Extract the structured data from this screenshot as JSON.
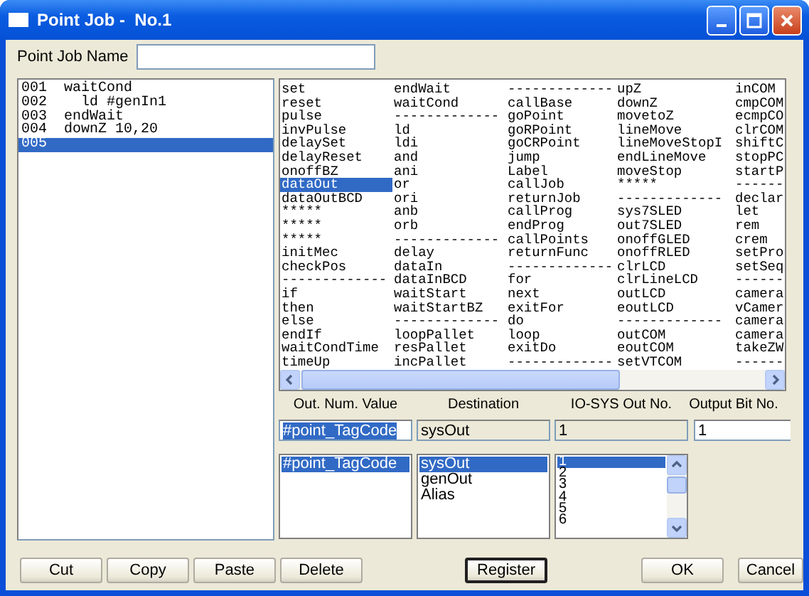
{
  "window": {
    "title": "Point Job -  No.1"
  },
  "job_name": {
    "label": "Point Job Name"
  },
  "code_lines": [
    {
      "no": "001",
      "text": "waitCond",
      "selected": false,
      "children": [
        {
          "no": "002",
          "text": "ld #genIn1",
          "selected": false
        }
      ]
    },
    {
      "no": "003",
      "text": "endWait",
      "selected": false
    },
    {
      "no": "004",
      "text": "downZ 10,20",
      "selected": false
    },
    {
      "no": "005",
      "selected": true
    }
  ],
  "commands": [
    [
      {
        "text": "set",
        "selected": false
      },
      {
        "text": "endWait",
        "selected": false
      },
      {
        "text": "-------------",
        "selected": false
      },
      {
        "text": "upZ",
        "selected": false
      },
      {
        "text": "inCOM",
        "selected": false
      }
    ],
    [
      {
        "text": "reset",
        "selected": false
      },
      {
        "text": "waitCond",
        "selected": false
      },
      {
        "text": "callBase",
        "selected": false
      },
      {
        "text": "downZ",
        "selected": false
      },
      {
        "text": "cmpCOM",
        "selected": false
      }
    ],
    [
      {
        "text": "pulse",
        "selected": false
      },
      {
        "text": "-------------",
        "selected": false
      },
      {
        "text": "goPoint",
        "selected": false
      },
      {
        "text": "movetoZ",
        "selected": false
      },
      {
        "text": "ecmpCO",
        "selected": false
      }
    ],
    [
      {
        "text": "invPulse",
        "selected": false
      },
      {
        "text": "ld",
        "selected": false
      },
      {
        "text": "goRPoint",
        "selected": false
      },
      {
        "text": "lineMove",
        "selected": false
      },
      {
        "text": "clrCOM",
        "selected": false
      }
    ],
    [
      {
        "text": "delaySet",
        "selected": false
      },
      {
        "text": "ldi",
        "selected": false
      },
      {
        "text": "goCRPoint",
        "selected": false
      },
      {
        "text": "lineMoveStopI",
        "selected": false
      },
      {
        "text": "shiftC",
        "selected": false
      }
    ],
    [
      {
        "text": "delayReset",
        "selected": false
      },
      {
        "text": "and",
        "selected": false
      },
      {
        "text": "jump",
        "selected": false
      },
      {
        "text": "endLineMove",
        "selected": false
      },
      {
        "text": "stopPC",
        "selected": false
      }
    ],
    [
      {
        "text": "onoffBZ",
        "selected": false
      },
      {
        "text": "ani",
        "selected": false
      },
      {
        "text": "Label",
        "selected": false
      },
      {
        "text": "moveStop",
        "selected": false
      },
      {
        "text": "startP",
        "selected": false
      }
    ],
    [
      {
        "text": "dataOut",
        "selected": true
      },
      {
        "text": "or",
        "selected": false
      },
      {
        "text": "callJob",
        "selected": false
      },
      {
        "text": "*****",
        "selected": false
      },
      {
        "text": "------",
        "selected": false
      }
    ],
    [
      {
        "text": "dataOutBCD",
        "selected": false
      },
      {
        "text": "ori",
        "selected": false
      },
      {
        "text": "returnJob",
        "selected": false
      },
      {
        "text": "-------------",
        "selected": false
      },
      {
        "text": "declar",
        "selected": false
      }
    ],
    [
      {
        "text": "*****",
        "selected": false
      },
      {
        "text": "anb",
        "selected": false
      },
      {
        "text": "callProg",
        "selected": false
      },
      {
        "text": "sys7SLED",
        "selected": false
      },
      {
        "text": "let",
        "selected": false
      }
    ],
    [
      {
        "text": "*****",
        "selected": false
      },
      {
        "text": "orb",
        "selected": false
      },
      {
        "text": "endProg",
        "selected": false
      },
      {
        "text": "out7SLED",
        "selected": false
      },
      {
        "text": "rem",
        "selected": false
      }
    ],
    [
      {
        "text": "*****",
        "selected": false
      },
      {
        "text": "-------------",
        "selected": false
      },
      {
        "text": "callPoints",
        "selected": false
      },
      {
        "text": "onoffGLED",
        "selected": false
      },
      {
        "text": "crem",
        "selected": false
      }
    ],
    [
      {
        "text": "initMec",
        "selected": false
      },
      {
        "text": "delay",
        "selected": false
      },
      {
        "text": "returnFunc",
        "selected": false
      },
      {
        "text": "onoffRLED",
        "selected": false
      },
      {
        "text": "setPro",
        "selected": false
      }
    ],
    [
      {
        "text": "checkPos",
        "selected": false
      },
      {
        "text": "dataIn",
        "selected": false
      },
      {
        "text": "-------------",
        "selected": false
      },
      {
        "text": "clrLCD",
        "selected": false
      },
      {
        "text": "setSeq",
        "selected": false
      }
    ],
    [
      {
        "text": "-------------",
        "selected": false
      },
      {
        "text": "dataInBCD",
        "selected": false
      },
      {
        "text": "for",
        "selected": false
      },
      {
        "text": "clrLineLCD",
        "selected": false
      },
      {
        "text": "------",
        "selected": false
      }
    ],
    [
      {
        "text": "if",
        "selected": false
      },
      {
        "text": "waitStart",
        "selected": false
      },
      {
        "text": "next",
        "selected": false
      },
      {
        "text": "outLCD",
        "selected": false
      },
      {
        "text": "camera",
        "selected": false
      }
    ],
    [
      {
        "text": "then",
        "selected": false
      },
      {
        "text": "waitStartBZ",
        "selected": false
      },
      {
        "text": "exitFor",
        "selected": false
      },
      {
        "text": "eoutLCD",
        "selected": false
      },
      {
        "text": "vCamer",
        "selected": false
      }
    ],
    [
      {
        "text": "else",
        "selected": false
      },
      {
        "text": "-------------",
        "selected": false
      },
      {
        "text": "do",
        "selected": false
      },
      {
        "text": "-------------",
        "selected": false
      },
      {
        "text": "camera",
        "selected": false
      }
    ],
    [
      {
        "text": "endIf",
        "selected": false
      },
      {
        "text": "loopPallet",
        "selected": false
      },
      {
        "text": "loop",
        "selected": false
      },
      {
        "text": "outCOM",
        "selected": false
      },
      {
        "text": "camera",
        "selected": false
      }
    ],
    [
      {
        "text": "waitCondTime",
        "selected": false
      },
      {
        "text": "resPallet",
        "selected": false
      },
      {
        "text": "exitDo",
        "selected": false
      },
      {
        "text": "eoutCOM",
        "selected": false
      },
      {
        "text": "takeZW",
        "selected": false
      }
    ],
    [
      {
        "text": "timeUp",
        "selected": false
      },
      {
        "text": "incPallet",
        "selected": false
      },
      {
        "text": "-------------",
        "selected": false
      },
      {
        "text": "setVTCOM",
        "selected": false
      },
      {
        "text": "------",
        "selected": false
      }
    ]
  ],
  "params": [
    {
      "header": "Out. Num. Value",
      "value": "#point_TagCode",
      "value_selected": true,
      "disabled": false,
      "items": [
        {
          "text": "#point_TagCode",
          "selected": true
        }
      ]
    },
    {
      "header": "Destination",
      "value": "sysOut",
      "value_selected": false,
      "disabled": true,
      "items": [
        {
          "text": "sysOut",
          "selected": true
        },
        {
          "text": "genOut",
          "selected": false
        },
        {
          "text": "Alias",
          "selected": false
        }
      ]
    },
    {
      "header": "IO-SYS Out No.",
      "value": "1",
      "value_selected": false,
      "disabled": true,
      "scrollbar": true,
      "items": [
        {
          "text": "1",
          "selected": true
        },
        {
          "text": "2",
          "selected": false
        },
        {
          "text": "3",
          "selected": false
        },
        {
          "text": "4",
          "selected": false
        },
        {
          "text": "5",
          "selected": false
        },
        {
          "text": "6",
          "selected": false
        }
      ]
    },
    {
      "header": "Output Bit No.",
      "value": "1",
      "value_selected": false,
      "disabled": false
    }
  ],
  "button_groups": [
    [
      {
        "label": "Cut",
        "default": false
      },
      {
        "label": "Copy",
        "default": false
      },
      {
        "label": "Paste",
        "default": false
      },
      {
        "label": "Delete",
        "default": false
      }
    ],
    [
      {
        "label": "Register",
        "default": true
      }
    ],
    [
      {
        "label": "OK",
        "default": false
      },
      {
        "label": "Cancel",
        "default": false
      }
    ]
  ]
}
